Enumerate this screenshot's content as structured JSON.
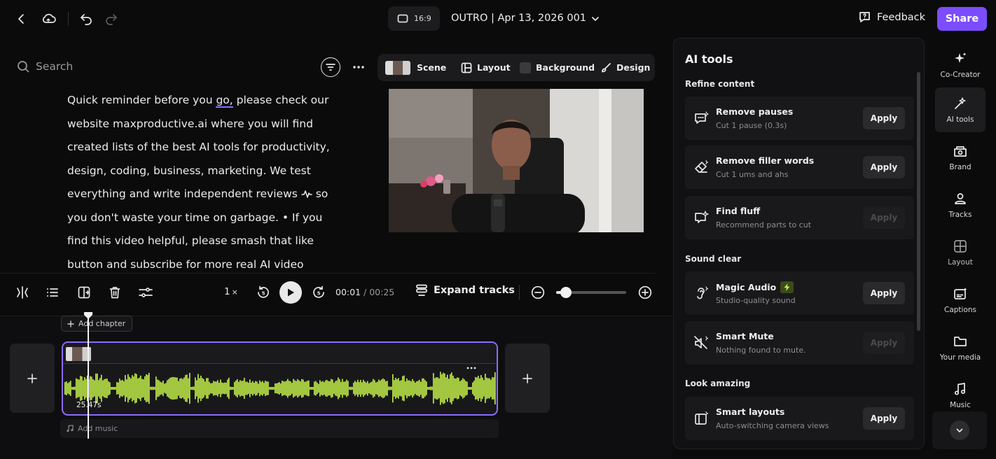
{
  "topbar": {
    "aspect_ratio": "16:9",
    "project_title": "OUTRO | Apr 13, 2026 001",
    "feedback_label": "Feedback",
    "share_label": "Share"
  },
  "search": {
    "placeholder": "Search"
  },
  "scene_toolbar": {
    "scene_label": "Scene",
    "layout_label": "Layout",
    "background_label": "Background",
    "design_label": "Design"
  },
  "transcript": {
    "lines": [
      "Quick reminder before you go, please check our",
      "website maxproductive.ai where you will find",
      "created lists of the best AI tools for productivity,",
      "design, coding, business, marketing. We test",
      "everything and write independent reviews",
      "you don't waste your time on garbage. • If you",
      "find this video helpful, please smash that like",
      "button and subscribe for more real AI video"
    ],
    "line1_pre": "Quick reminder before you ",
    "line1_underlined": "go,",
    "line1_post": " please check our",
    "line5_pre": "everything and write independent reviews",
    "line5_post": "so"
  },
  "playback": {
    "speed_label": "1",
    "speed_suffix": "×",
    "current_time": "00:01",
    "separator": "/",
    "total_time": "00:25",
    "expand_label": "Expand tracks",
    "zoom_level": 0.14
  },
  "timeline": {
    "add_chapter_label": "Add chapter",
    "clip_duration": "25.47s",
    "add_music_label": "Add music"
  },
  "ai_tools": {
    "title": "AI tools",
    "sections": {
      "refine": "Refine content",
      "sound": "Sound clear",
      "look": "Look amazing"
    },
    "apply_label": "Apply",
    "tools": [
      {
        "name": "Remove pauses",
        "desc": "Cut 1 pause (0.3s)"
      },
      {
        "name": "Remove filler words",
        "desc": "Cut 1 ums and ahs"
      },
      {
        "name": "Find fluff",
        "desc": "Recommend parts to cut"
      },
      {
        "name": "Magic Audio",
        "desc": "Studio-quality sound"
      },
      {
        "name": "Smart Mute",
        "desc": "Nothing found to mute."
      },
      {
        "name": "Smart layouts",
        "desc": "Auto-switching camera views"
      }
    ]
  },
  "rail": {
    "items": [
      "Co-Creator",
      "AI tools",
      "Brand",
      "Tracks",
      "Layout",
      "Captions",
      "Your media",
      "Music"
    ]
  },
  "colors": {
    "accent": "#7b4dff",
    "waveform": "#c6f24b",
    "selection_border": "#8d6cff"
  }
}
